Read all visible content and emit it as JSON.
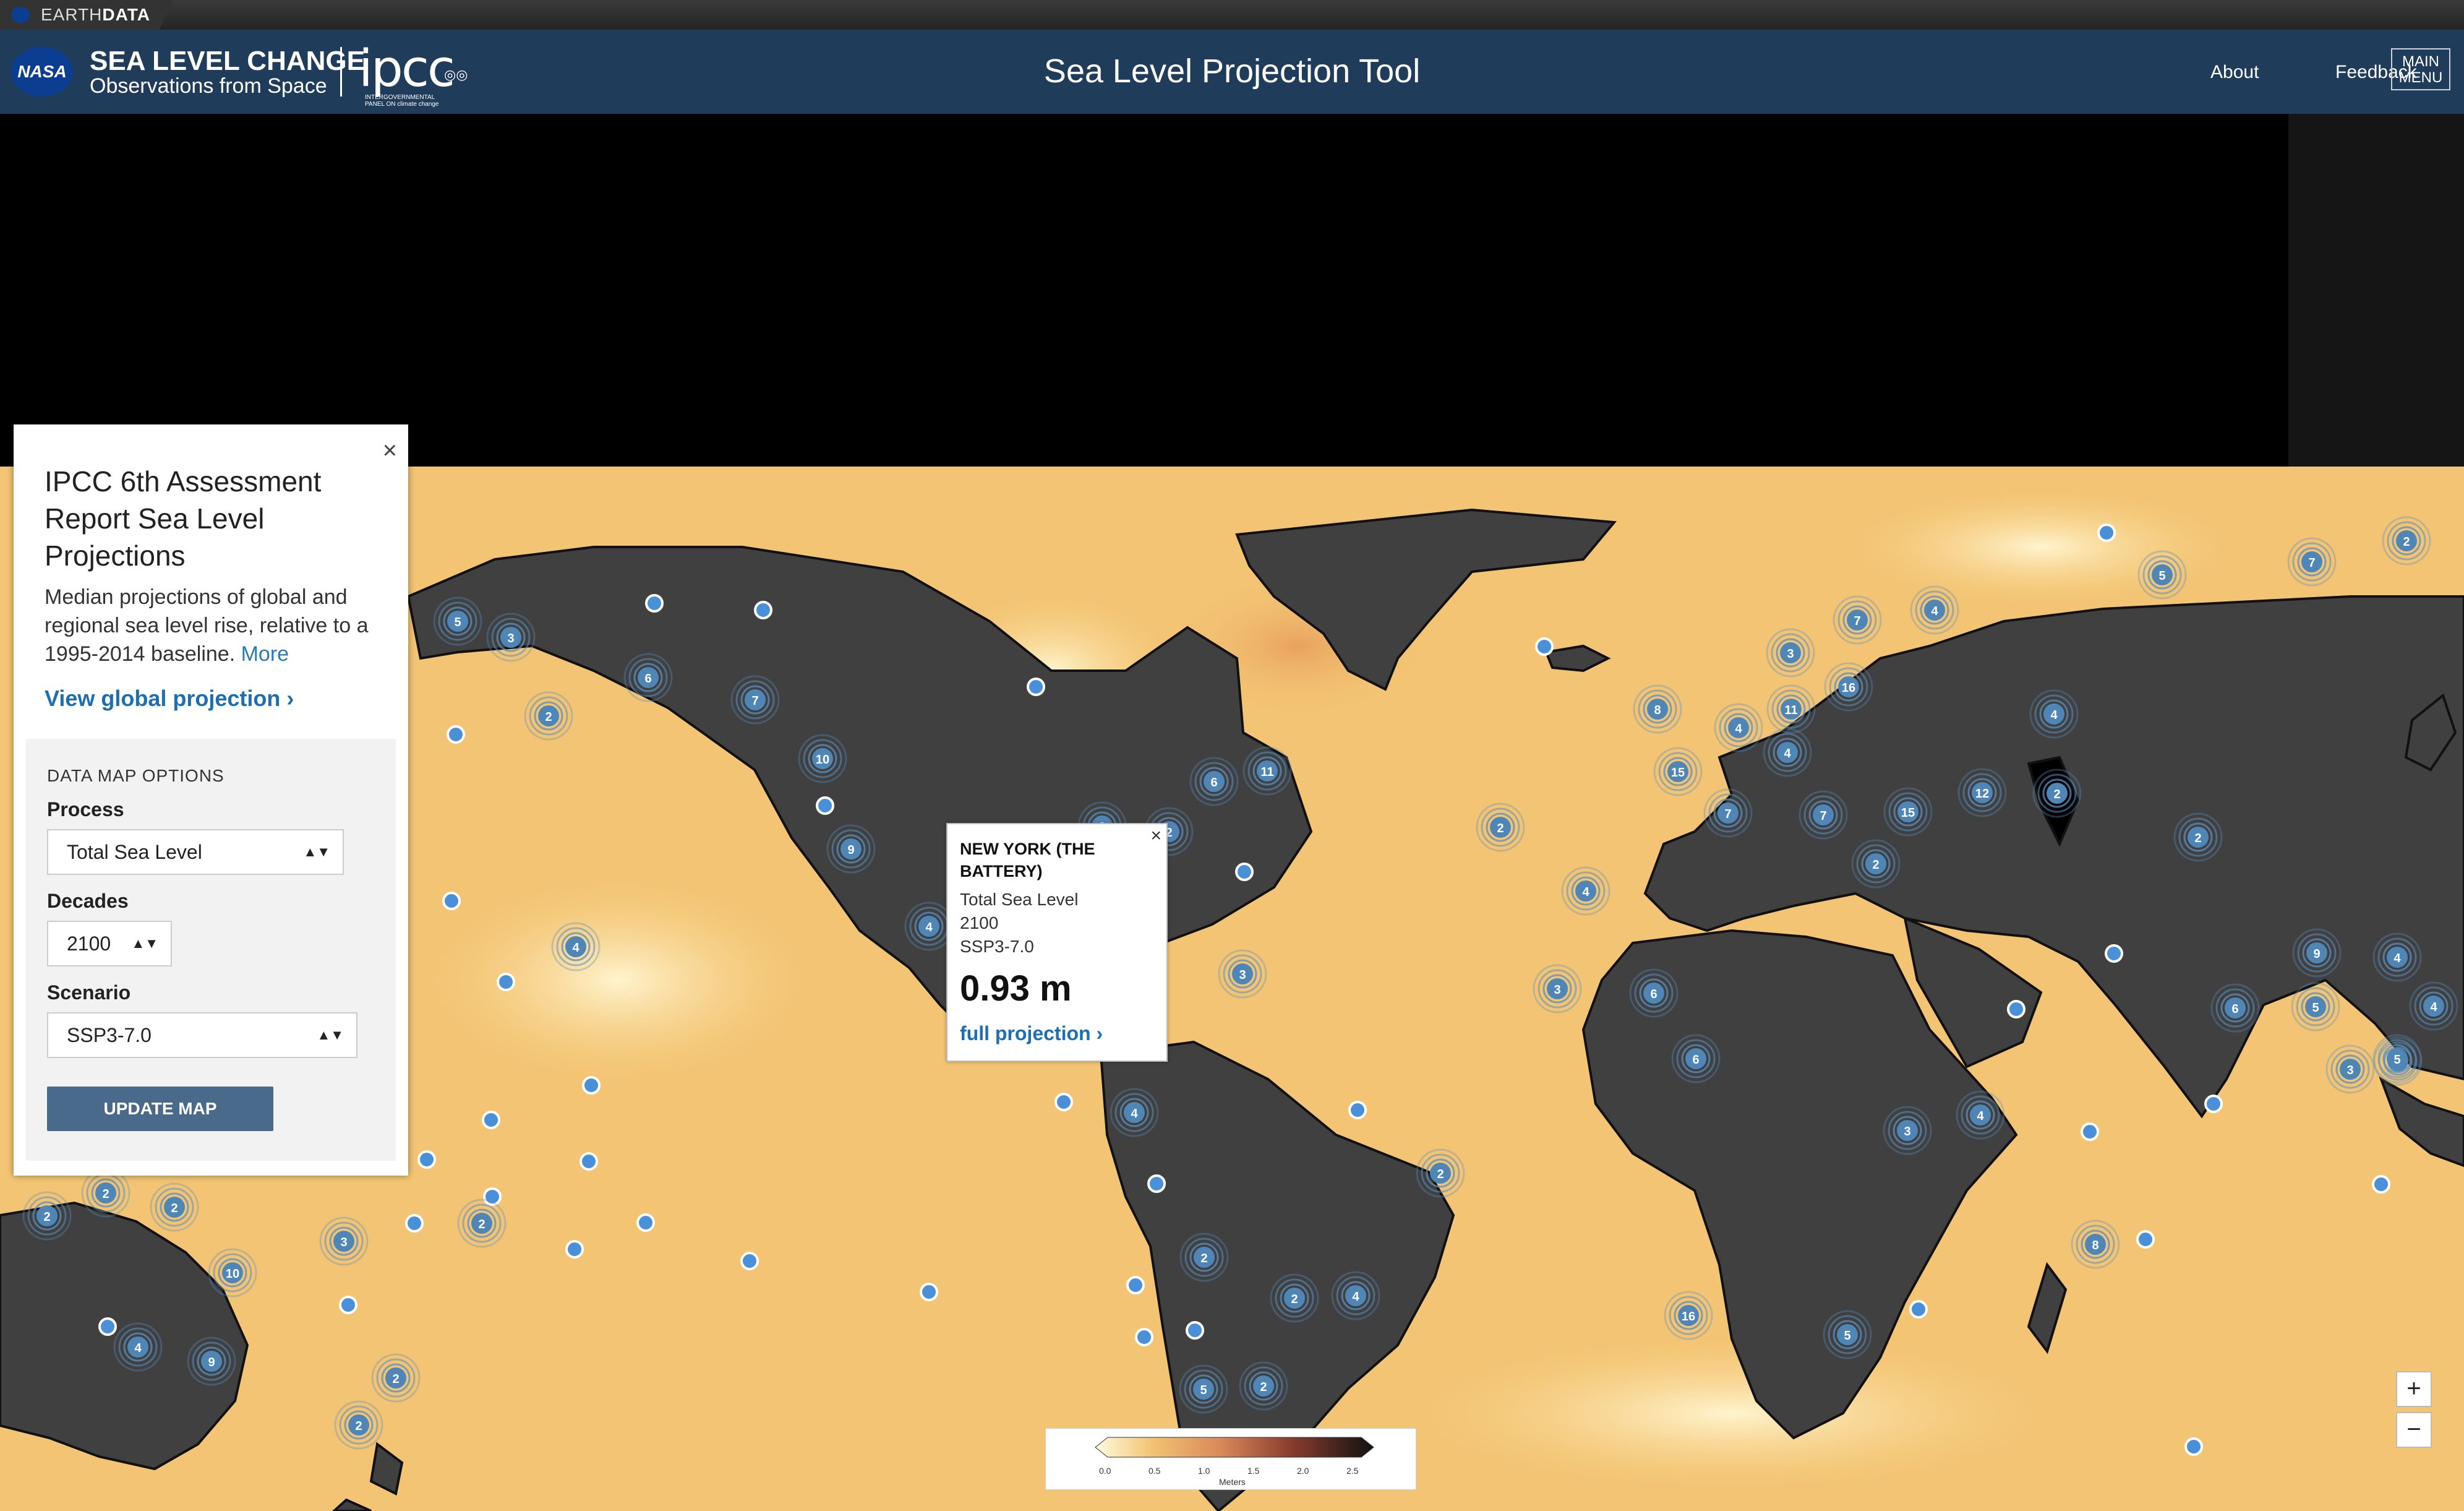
{
  "earthdata": {
    "prefix": "EARTH",
    "bold": "DATA"
  },
  "header": {
    "logo_text": "NASA",
    "brand_title": "SEA LEVEL CHANGE",
    "brand_subtitle": "Observations from Space",
    "ipcc_logo": "ipcc",
    "ipcc_small": "INTERGOVERNMENTAL PANEL ON climate change",
    "tool_title": "Sea Level Projection Tool",
    "nav": {
      "about": "About",
      "feedback": "Feedback",
      "menu_line1": "MAIN",
      "menu_line2": "MENU"
    }
  },
  "panel": {
    "close": "×",
    "title": "IPCC 6th Assessment Report Sea Level Projections",
    "description": "Median projections of global and regional sea level rise, relative to a 1995-2014 baseline.",
    "more_link": "More",
    "global_link": "View global projection ›",
    "options_heading": "DATA MAP OPTIONS",
    "process_label": "Process",
    "process_value": "Total Sea Level",
    "decades_label": "Decades",
    "decades_value": "2100",
    "scenario_label": "Scenario",
    "scenario_value": "SSP3-7.0",
    "select_arrow": "▲▼",
    "update_button": "UPDATE MAP"
  },
  "popup": {
    "close": "×",
    "location": "NEW YORK (THE BATTERY)",
    "process": "Total Sea Level",
    "decade": "2100",
    "scenario": "SSP3-7.0",
    "value": "0.93 m",
    "link": "full projection ›"
  },
  "zoom": {
    "in": "+",
    "out": "−"
  },
  "legend": {
    "ticks": [
      "0.0",
      "0.5",
      "1.0",
      "1.5",
      "2.0",
      "2.5"
    ],
    "unit": "Meters"
  },
  "colors": {
    "ocean": "#f3c474",
    "land": "#404040",
    "marker": "#4a90d9",
    "header": "#1f3c5b"
  },
  "clusters": [
    "5",
    "3",
    "6",
    "2",
    "7",
    "10",
    "9",
    "4",
    "4",
    "2",
    "6",
    "11",
    "2",
    "4",
    "3",
    "3",
    "4",
    "2",
    "2",
    "5",
    "10",
    "2",
    "2",
    "4",
    "9",
    "6",
    "2",
    "2",
    "4",
    "3",
    "2",
    "2",
    "4",
    "2",
    "2",
    "5",
    "2",
    "6",
    "8",
    "15",
    "7",
    "16",
    "4",
    "11",
    "15",
    "7",
    "12",
    "16",
    "7",
    "4",
    "2",
    "6",
    "4",
    "3",
    "8",
    "7",
    "4",
    "4",
    "3",
    "2",
    "2",
    "2",
    "5",
    "9",
    "4",
    "5",
    "3",
    "4",
    "5"
  ]
}
